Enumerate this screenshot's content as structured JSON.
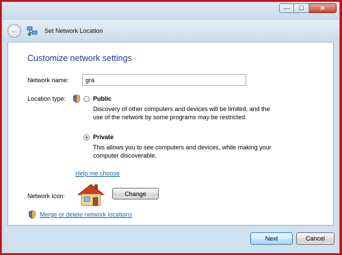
{
  "window": {
    "controls": {
      "minimize": "—",
      "maximize": "☐",
      "close": "✕"
    },
    "close_color": "#c5452f"
  },
  "nav": {
    "back_icon": "←",
    "title": "Set Network Location"
  },
  "main": {
    "heading": "Customize network settings",
    "network_name_label": "Network name:",
    "network_name_value": "gra",
    "location_type_label": "Location type:",
    "options": [
      {
        "title": "Public",
        "selected": false,
        "description": "Discovery of other computers and devices will be limited, and the use of the network by some programs may be restricted."
      },
      {
        "title": "Private",
        "selected": true,
        "description": "This allows you to see computers and devices, while making your computer discoverable."
      }
    ],
    "help_link": "Help me choose",
    "network_icon_label": "Network Icon:",
    "change_button": "Change",
    "merge_link": "Merge or delete network locations"
  },
  "footer": {
    "next_button": "Next",
    "cancel_button": "Cancel"
  },
  "colors": {
    "heading": "#1f3d8c",
    "link": "#1f62b7",
    "desktop_background": "#c40f12"
  }
}
